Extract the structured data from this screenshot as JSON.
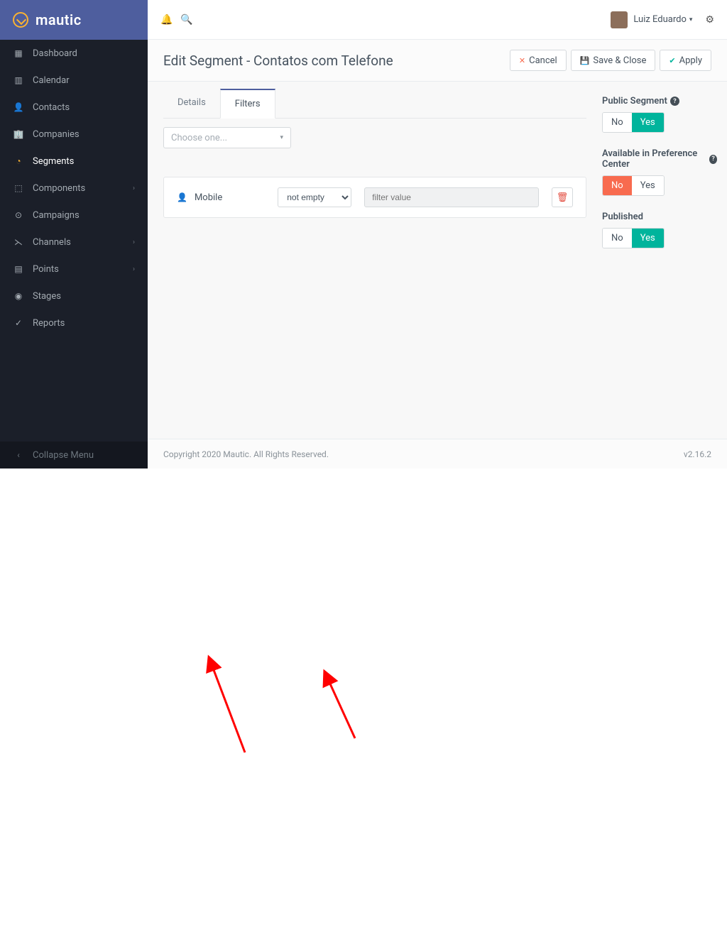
{
  "brand": {
    "name": "mautic"
  },
  "sidebar": {
    "items": [
      {
        "icon": "▦",
        "label": "Dashboard"
      },
      {
        "icon": "▥",
        "label": "Calendar"
      },
      {
        "icon": "👤",
        "label": "Contacts"
      },
      {
        "icon": "🏢",
        "label": "Companies"
      },
      {
        "icon": "◔",
        "label": "Segments"
      },
      {
        "icon": "⬚",
        "label": "Components",
        "hasSub": true
      },
      {
        "icon": "⊙",
        "label": "Campaigns"
      },
      {
        "icon": "⋋",
        "label": "Channels",
        "hasSub": true
      },
      {
        "icon": "▤",
        "label": "Points",
        "hasSub": true
      },
      {
        "icon": "◉",
        "label": "Stages"
      },
      {
        "icon": "✓",
        "label": "Reports"
      }
    ],
    "collapse": "Collapse Menu"
  },
  "topbar": {
    "user": "Luiz Eduardo"
  },
  "page": {
    "title": "Edit Segment - Contatos com Telefone",
    "actions": {
      "cancel": "Cancel",
      "saveClose": "Save & Close",
      "apply": "Apply"
    }
  },
  "tabs": {
    "details": "Details",
    "filters": "Filters"
  },
  "filterPicker": {
    "placeholder": "Choose one..."
  },
  "filterRow": {
    "field": "Mobile",
    "operator": "not empty",
    "placeholder": "filter value"
  },
  "settings": {
    "publicSegment": {
      "label": "Public Segment",
      "no": "No",
      "yes": "Yes",
      "value": "yes"
    },
    "prefCenter": {
      "label": "Available in Preference Center",
      "no": "No",
      "yes": "Yes",
      "value": "no"
    },
    "published": {
      "label": "Published",
      "no": "No",
      "yes": "Yes",
      "value": "yes"
    }
  },
  "footer": {
    "copyright": "Copyright 2020 Mautic. All Rights Reserved.",
    "version": "v2.16.2"
  }
}
